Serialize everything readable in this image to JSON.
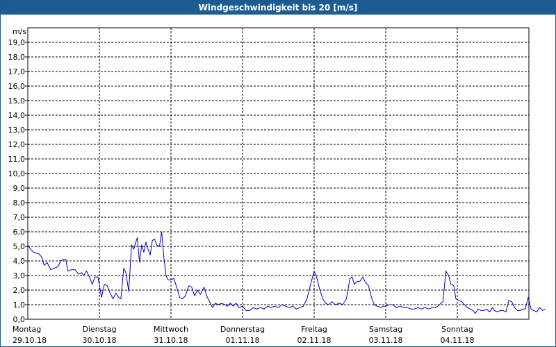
{
  "window": {
    "title": "Windgeschwindigkeit bis 20 [m/s]"
  },
  "colors": {
    "title_bar": "#1b5c93",
    "title_text": "#ffffff",
    "line": "#0000b4",
    "grid": "#000000",
    "axis": "#000000"
  },
  "chart_data": {
    "type": "line",
    "title": "Windgeschwindigkeit bis 20 [m/s]",
    "ylabel": "m/s",
    "xlabel": "",
    "ylim": [
      0,
      20
    ],
    "xlim_days": [
      0,
      7
    ],
    "y_ticks": [
      "0,0",
      "1,0",
      "2,0",
      "3,0",
      "4,0",
      "5,0",
      "6,0",
      "7,0",
      "8,0",
      "9,0",
      "10,0",
      "11,0",
      "12,0",
      "13,0",
      "14,0",
      "15,0",
      "16,0",
      "17,0",
      "18,0",
      "19,0"
    ],
    "x_ticks": [
      {
        "day": "Montag",
        "date": "29.10.18"
      },
      {
        "day": "Dienstag",
        "date": "30.10.18"
      },
      {
        "day": "Mittwoch",
        "date": "31.10.18"
      },
      {
        "day": "Donnerstag",
        "date": "01.11.18"
      },
      {
        "day": "Freitag",
        "date": "02.11.18"
      },
      {
        "day": "Samstag",
        "date": "03.11.18"
      },
      {
        "day": "Sonntag",
        "date": "04.11.18"
      }
    ],
    "grid": true,
    "legend": "none",
    "series": [
      {
        "values": [
          [
            0.0,
            5.1
          ],
          [
            0.04,
            4.8
          ],
          [
            0.08,
            4.6
          ],
          [
            0.15,
            4.5
          ],
          [
            0.19,
            4.3
          ],
          [
            0.23,
            3.7
          ],
          [
            0.27,
            3.9
          ],
          [
            0.32,
            3.4
          ],
          [
            0.37,
            3.5
          ],
          [
            0.42,
            3.6
          ],
          [
            0.46,
            4.0
          ],
          [
            0.5,
            4.1
          ],
          [
            0.53,
            4.1
          ],
          [
            0.56,
            3.3
          ],
          [
            0.61,
            3.4
          ],
          [
            0.66,
            3.4
          ],
          [
            0.71,
            3.1
          ],
          [
            0.75,
            3.2
          ],
          [
            0.78,
            3.0
          ],
          [
            0.82,
            3.3
          ],
          [
            0.86,
            2.9
          ],
          [
            0.9,
            2.4
          ],
          [
            0.94,
            2.9
          ],
          [
            0.98,
            2.9
          ],
          [
            1.03,
            1.5
          ],
          [
            1.07,
            2.4
          ],
          [
            1.11,
            2.3
          ],
          [
            1.15,
            1.8
          ],
          [
            1.19,
            1.4
          ],
          [
            1.23,
            1.8
          ],
          [
            1.27,
            1.5
          ],
          [
            1.3,
            1.4
          ],
          [
            1.34,
            3.5
          ],
          [
            1.37,
            3.2
          ],
          [
            1.41,
            1.9
          ],
          [
            1.45,
            5.1
          ],
          [
            1.48,
            4.8
          ],
          [
            1.51,
            5.3
          ],
          [
            1.53,
            5.6
          ],
          [
            1.56,
            3.9
          ],
          [
            1.59,
            5.1
          ],
          [
            1.62,
            4.6
          ],
          [
            1.65,
            5.3
          ],
          [
            1.68,
            4.8
          ],
          [
            1.71,
            4.4
          ],
          [
            1.74,
            5.4
          ],
          [
            1.77,
            5.5
          ],
          [
            1.8,
            5.1
          ],
          [
            1.84,
            5.0
          ],
          [
            1.87,
            6.0
          ],
          [
            1.9,
            4.3
          ],
          [
            1.93,
            3.0
          ],
          [
            1.96,
            2.7
          ],
          [
            2.0,
            2.7
          ],
          [
            2.04,
            2.8
          ],
          [
            2.08,
            2.2
          ],
          [
            2.12,
            1.5
          ],
          [
            2.16,
            1.4
          ],
          [
            2.2,
            1.6
          ],
          [
            2.25,
            2.3
          ],
          [
            2.29,
            2.2
          ],
          [
            2.33,
            1.6
          ],
          [
            2.37,
            2.0
          ],
          [
            2.41,
            1.7
          ],
          [
            2.46,
            2.2
          ],
          [
            2.5,
            1.6
          ],
          [
            2.54,
            1.2
          ],
          [
            2.58,
            0.8
          ],
          [
            2.62,
            1.1
          ],
          [
            2.66,
            1.0
          ],
          [
            2.71,
            1.1
          ],
          [
            2.75,
            1.0
          ],
          [
            2.79,
            0.9
          ],
          [
            2.83,
            1.1
          ],
          [
            2.87,
            0.9
          ],
          [
            2.91,
            1.1
          ],
          [
            2.95,
            0.8
          ],
          [
            3.0,
            0.9
          ],
          [
            3.05,
            0.6
          ],
          [
            3.1,
            0.6
          ],
          [
            3.15,
            0.8
          ],
          [
            3.2,
            0.7
          ],
          [
            3.25,
            0.8
          ],
          [
            3.3,
            0.7
          ],
          [
            3.35,
            0.9
          ],
          [
            3.4,
            0.8
          ],
          [
            3.45,
            0.9
          ],
          [
            3.5,
            0.8
          ],
          [
            3.55,
            1.0
          ],
          [
            3.6,
            0.9
          ],
          [
            3.65,
            0.8
          ],
          [
            3.7,
            0.9
          ],
          [
            3.75,
            0.7
          ],
          [
            3.8,
            0.8
          ],
          [
            3.85,
            0.9
          ],
          [
            3.9,
            1.4
          ],
          [
            3.95,
            2.4
          ],
          [
            4.0,
            3.3
          ],
          [
            4.04,
            2.8
          ],
          [
            4.08,
            2.0
          ],
          [
            4.12,
            1.4
          ],
          [
            4.16,
            1.1
          ],
          [
            4.2,
            1.0
          ],
          [
            4.25,
            1.2
          ],
          [
            4.3,
            1.0
          ],
          [
            4.35,
            1.1
          ],
          [
            4.4,
            1.0
          ],
          [
            4.45,
            1.4
          ],
          [
            4.5,
            2.8
          ],
          [
            4.53,
            2.9
          ],
          [
            4.56,
            2.4
          ],
          [
            4.6,
            2.6
          ],
          [
            4.64,
            2.6
          ],
          [
            4.68,
            2.9
          ],
          [
            4.72,
            2.5
          ],
          [
            4.76,
            2.3
          ],
          [
            4.8,
            1.5
          ],
          [
            4.84,
            1.0
          ],
          [
            4.88,
            0.9
          ],
          [
            4.93,
            0.8
          ],
          [
            4.97,
            0.9
          ],
          [
            5.0,
            0.9
          ],
          [
            5.05,
            1.0
          ],
          [
            5.1,
            1.0
          ],
          [
            5.15,
            0.8
          ],
          [
            5.2,
            0.9
          ],
          [
            5.25,
            0.8
          ],
          [
            5.3,
            0.8
          ],
          [
            5.35,
            0.7
          ],
          [
            5.4,
            0.7
          ],
          [
            5.45,
            0.8
          ],
          [
            5.5,
            0.7
          ],
          [
            5.55,
            0.8
          ],
          [
            5.6,
            0.7
          ],
          [
            5.65,
            0.8
          ],
          [
            5.7,
            0.8
          ],
          [
            5.75,
            1.0
          ],
          [
            5.8,
            1.2
          ],
          [
            5.84,
            3.3
          ],
          [
            5.88,
            3.0
          ],
          [
            5.91,
            2.4
          ],
          [
            5.95,
            2.3
          ],
          [
            5.98,
            1.4
          ],
          [
            6.02,
            1.3
          ],
          [
            6.06,
            1.2
          ],
          [
            6.1,
            1.0
          ],
          [
            6.14,
            0.8
          ],
          [
            6.18,
            0.7
          ],
          [
            6.22,
            0.6
          ],
          [
            6.25,
            0.4
          ],
          [
            6.29,
            0.7
          ],
          [
            6.33,
            0.6
          ],
          [
            6.37,
            0.6
          ],
          [
            6.41,
            0.7
          ],
          [
            6.45,
            0.5
          ],
          [
            6.49,
            0.8
          ],
          [
            6.52,
            0.6
          ],
          [
            6.56,
            0.5
          ],
          [
            6.6,
            0.6
          ],
          [
            6.64,
            0.6
          ],
          [
            6.68,
            0.5
          ],
          [
            6.72,
            1.3
          ],
          [
            6.76,
            1.2
          ],
          [
            6.8,
            0.8
          ],
          [
            6.84,
            0.6
          ],
          [
            6.88,
            0.6
          ],
          [
            6.91,
            0.7
          ],
          [
            6.95,
            0.7
          ],
          [
            6.99,
            1.5
          ],
          [
            7.03,
            0.7
          ],
          [
            7.07,
            0.6
          ],
          [
            7.11,
            0.5
          ],
          [
            7.15,
            0.8
          ],
          [
            7.19,
            0.6
          ],
          [
            7.23,
            0.7
          ]
        ]
      }
    ]
  }
}
